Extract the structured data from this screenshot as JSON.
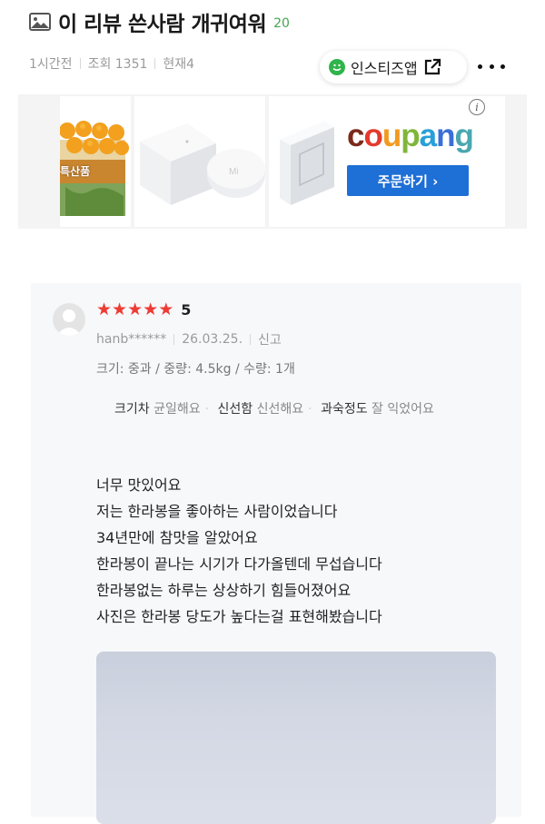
{
  "post": {
    "title": "이 리뷰 쓴사람 개귀여워",
    "comment_count": "20",
    "time_ago": "1시간전",
    "views": "조회 1351",
    "current": "현재4"
  },
  "toolbar": {
    "app_label": "인스티즈앱",
    "brand_color": "#2fb44b"
  },
  "ad": {
    "brand": [
      "c",
      "o",
      "u",
      "p",
      "a",
      "n",
      "g"
    ],
    "button_label": "주문하기 ›",
    "button_color": "#1e6fd6",
    "tile_text": "특산품"
  },
  "review": {
    "stars": [
      "★",
      "★",
      "★",
      "★",
      "★"
    ],
    "star_color": "#ef3b35",
    "rating": "5",
    "user": "hanb******",
    "date": "26.03.25.",
    "report_label": "신고",
    "options": "크기: 중과 / 중량: 4.5kg / 수량: 1개",
    "evaluations": [
      {
        "key": "크기차",
        "value": "균일해요"
      },
      {
        "key": "신선함",
        "value": "신선해요"
      },
      {
        "key": "과숙정도",
        "value": "잘 익었어요"
      }
    ],
    "body_lines": [
      "너무 맛있어요",
      "저는 한라봉을 좋아하는 사람이었습니다",
      "34년만에 참맛을 알았어요",
      "한라봉이 끝나는 시기가 다가올텐데 무섭습니다",
      "한라봉없는 하루는 상상하기 힘들어졌어요",
      "사진은 한라봉 당도가 높다는걸 표현해봤습니다"
    ]
  }
}
